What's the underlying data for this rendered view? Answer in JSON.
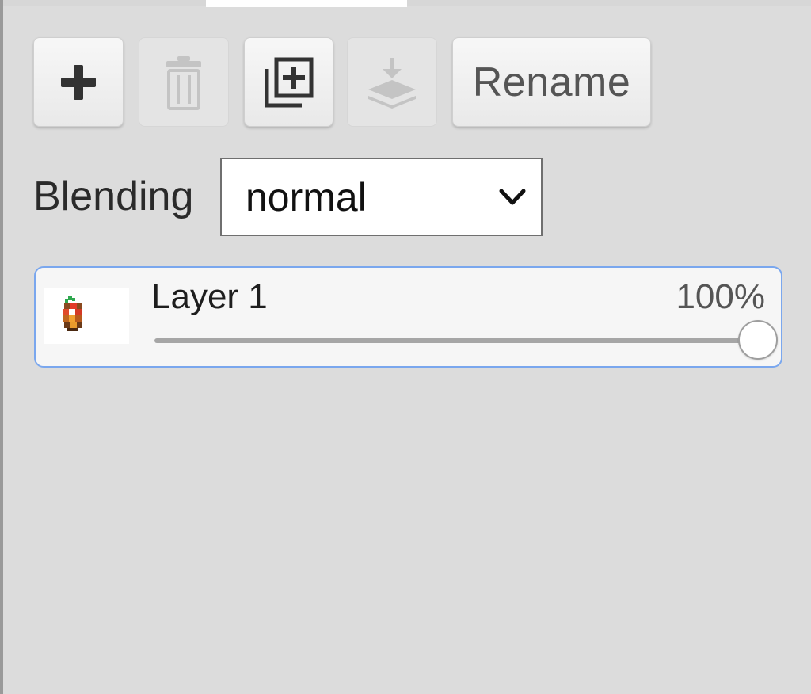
{
  "toolbar": {
    "add_icon": "plus-icon",
    "delete_icon": "trash-icon",
    "duplicate_icon": "duplicate-layer-icon",
    "merge_icon": "merge-down-icon",
    "rename_label": "Rename",
    "delete_enabled": false,
    "merge_enabled": false
  },
  "blending": {
    "label": "Blending",
    "selected": "normal"
  },
  "layers": [
    {
      "name": "Layer 1",
      "opacity_label": "100%",
      "opacity_value": 100,
      "selected": true
    }
  ],
  "colors": {
    "panel_bg": "#dcdcdc",
    "selected_border": "#7aa7ee",
    "disabled_icon": "#c2c2c2",
    "enabled_icon": "#333333"
  }
}
